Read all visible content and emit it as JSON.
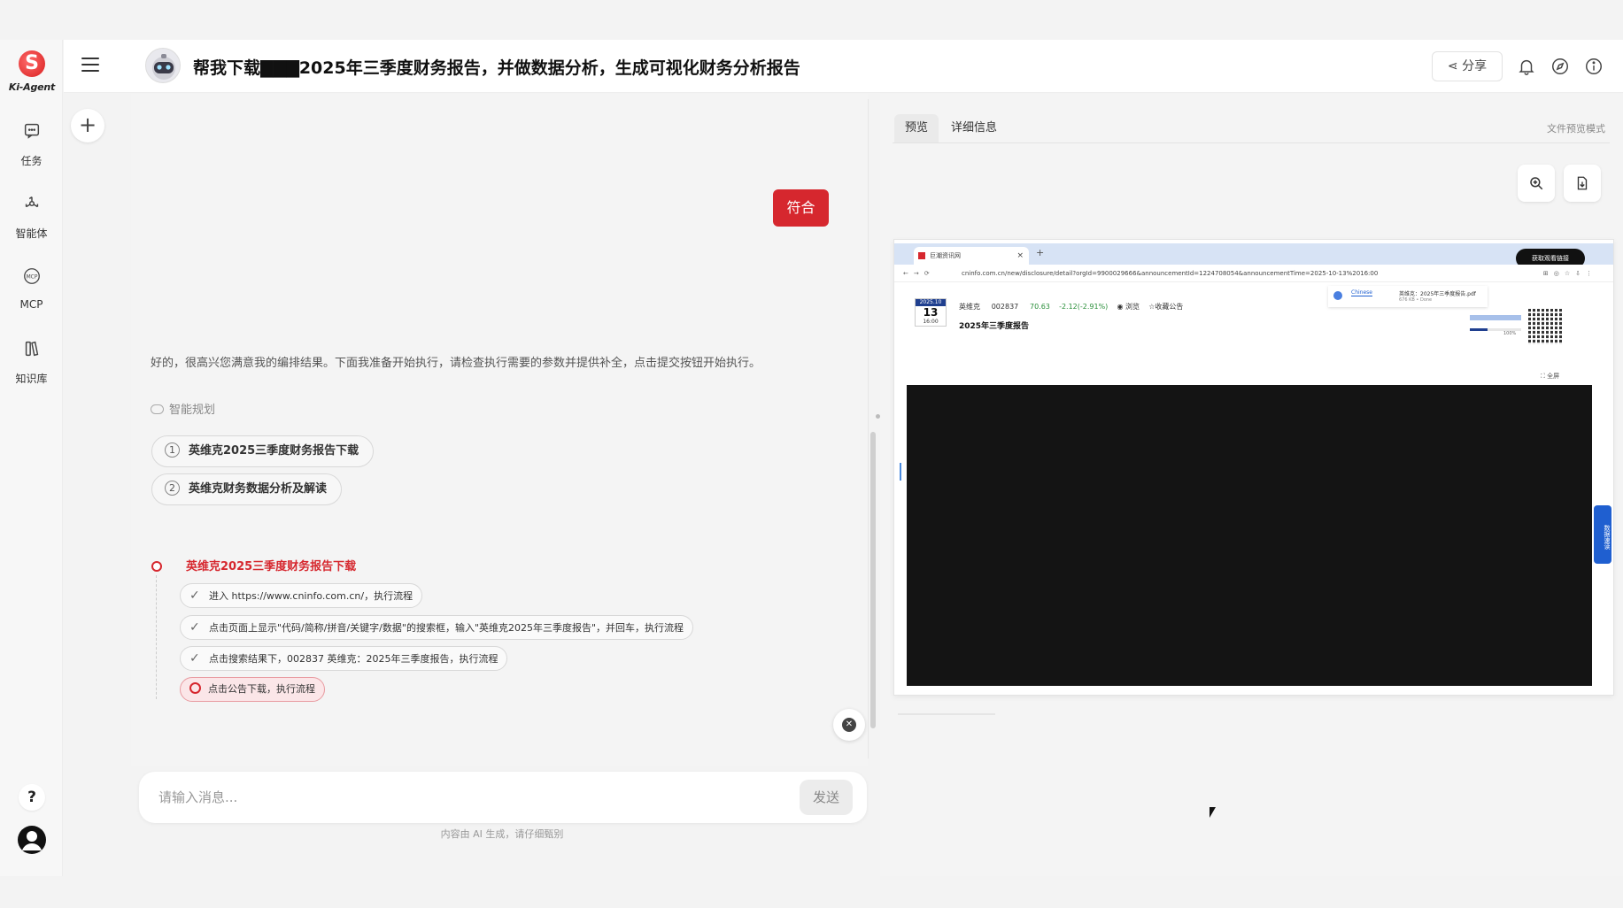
{
  "app": {
    "brand": "Ki-Agent",
    "title": "帮我下载▇▇▇2025年三季度财务报告，并做数据分析，生成可视化财务分析报告"
  },
  "sidebar": {
    "items": [
      {
        "label": "任务",
        "icon": "chat-icon"
      },
      {
        "label": "智能体",
        "icon": "agent-icon"
      },
      {
        "label": "MCP",
        "icon": "mcp-icon"
      },
      {
        "label": "知识库",
        "icon": "book-icon"
      }
    ],
    "help": "?"
  },
  "header": {
    "share_label": "分享",
    "icons": [
      "bell-icon",
      "compass-icon",
      "info-icon"
    ]
  },
  "chat": {
    "user_reply": "符合",
    "assistant_message": "好的，很高兴您满意我的编排结果。下面我准备开始执行，请检查执行需要的参数并提供补全，点击提交按钮开始执行。",
    "plan_label": "智能规划",
    "plan_steps": [
      {
        "num": "1",
        "label": "英维克2025三季度财务报告下载"
      },
      {
        "num": "2",
        "label": "英维克财务数据分析及解读"
      }
    ],
    "timeline_title": "英维克2025三季度财务报告下载",
    "timeline_steps": [
      {
        "label": "进入 https://www.cninfo.com.cn/，执行流程",
        "state": "done"
      },
      {
        "label": "点击页面上显示\"代码/简称/拼音/关键字/数据\"的搜索框，输入\"英维克2025年三季度报告\"，并回车，执行流程",
        "state": "done"
      },
      {
        "label": "点击搜索结果下，002837 英维克：2025年三季度报告，执行流程",
        "state": "done"
      },
      {
        "label": "点击公告下载，执行流程",
        "state": "running"
      }
    ],
    "input_placeholder": "请输入消息...",
    "send_label": "发送",
    "disclaimer": "内容由 AI 生成，请仔细甄别"
  },
  "preview_panel": {
    "tabs": [
      {
        "label": "预览",
        "active": true
      },
      {
        "label": "详细信息",
        "active": false
      }
    ],
    "mode_label": "文件预览模式",
    "browser": {
      "tab_title": "巨潮资讯网",
      "cta": "获取观看链接",
      "url": "cninfo.com.cn/new/disclosure/detail?orgId=9900029666&announcementId=1224708054&announcementTime=2025-10-13%2016:00",
      "date_month": "2025.10",
      "date_day": "13",
      "date_time": "16:00",
      "stock_name": "英维克",
      "stock_code": "002837",
      "price": "70.63",
      "change": "-2.12(-2.91%)",
      "browse": "浏览",
      "favorite": "☆收藏公告",
      "report_title": "2025年三季度报告",
      "popup_tab": "Chinese",
      "download_name": "英维克：2025年三季度报告.pdf",
      "download_meta": "676 KB • Done",
      "download_pct": "100%",
      "fullscreen": "全屏",
      "side_button": "数据速读"
    }
  },
  "colors": {
    "accent": "#d6272e",
    "pdf_bg": "#141414",
    "link_blue": "#1f5fd0"
  }
}
